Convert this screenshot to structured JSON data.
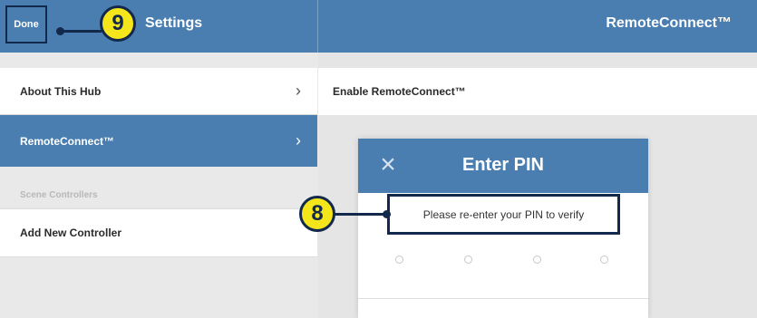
{
  "header": {
    "done_label": "Done",
    "left_title": "Settings",
    "right_title": "RemoteConnect™"
  },
  "sidebar": {
    "items": [
      {
        "label": "About This Hub",
        "chevron": "›"
      },
      {
        "label": "RemoteConnect™",
        "chevron": "›",
        "selected": true
      }
    ],
    "section_label": "Scene Controllers",
    "add_controller_label": "Add New Controller"
  },
  "main": {
    "enable_label": "Enable RemoteConnect™"
  },
  "modal": {
    "close_icon": "×",
    "title": "Enter PIN",
    "prompt": "Please re-enter your PIN to verify",
    "pin_length": 4
  },
  "callouts": {
    "done_number": "9",
    "prompt_number": "8"
  },
  "colors": {
    "accent": "#4a7eb0",
    "callout_fill": "#f5e61c",
    "callout_border": "#13294b"
  }
}
